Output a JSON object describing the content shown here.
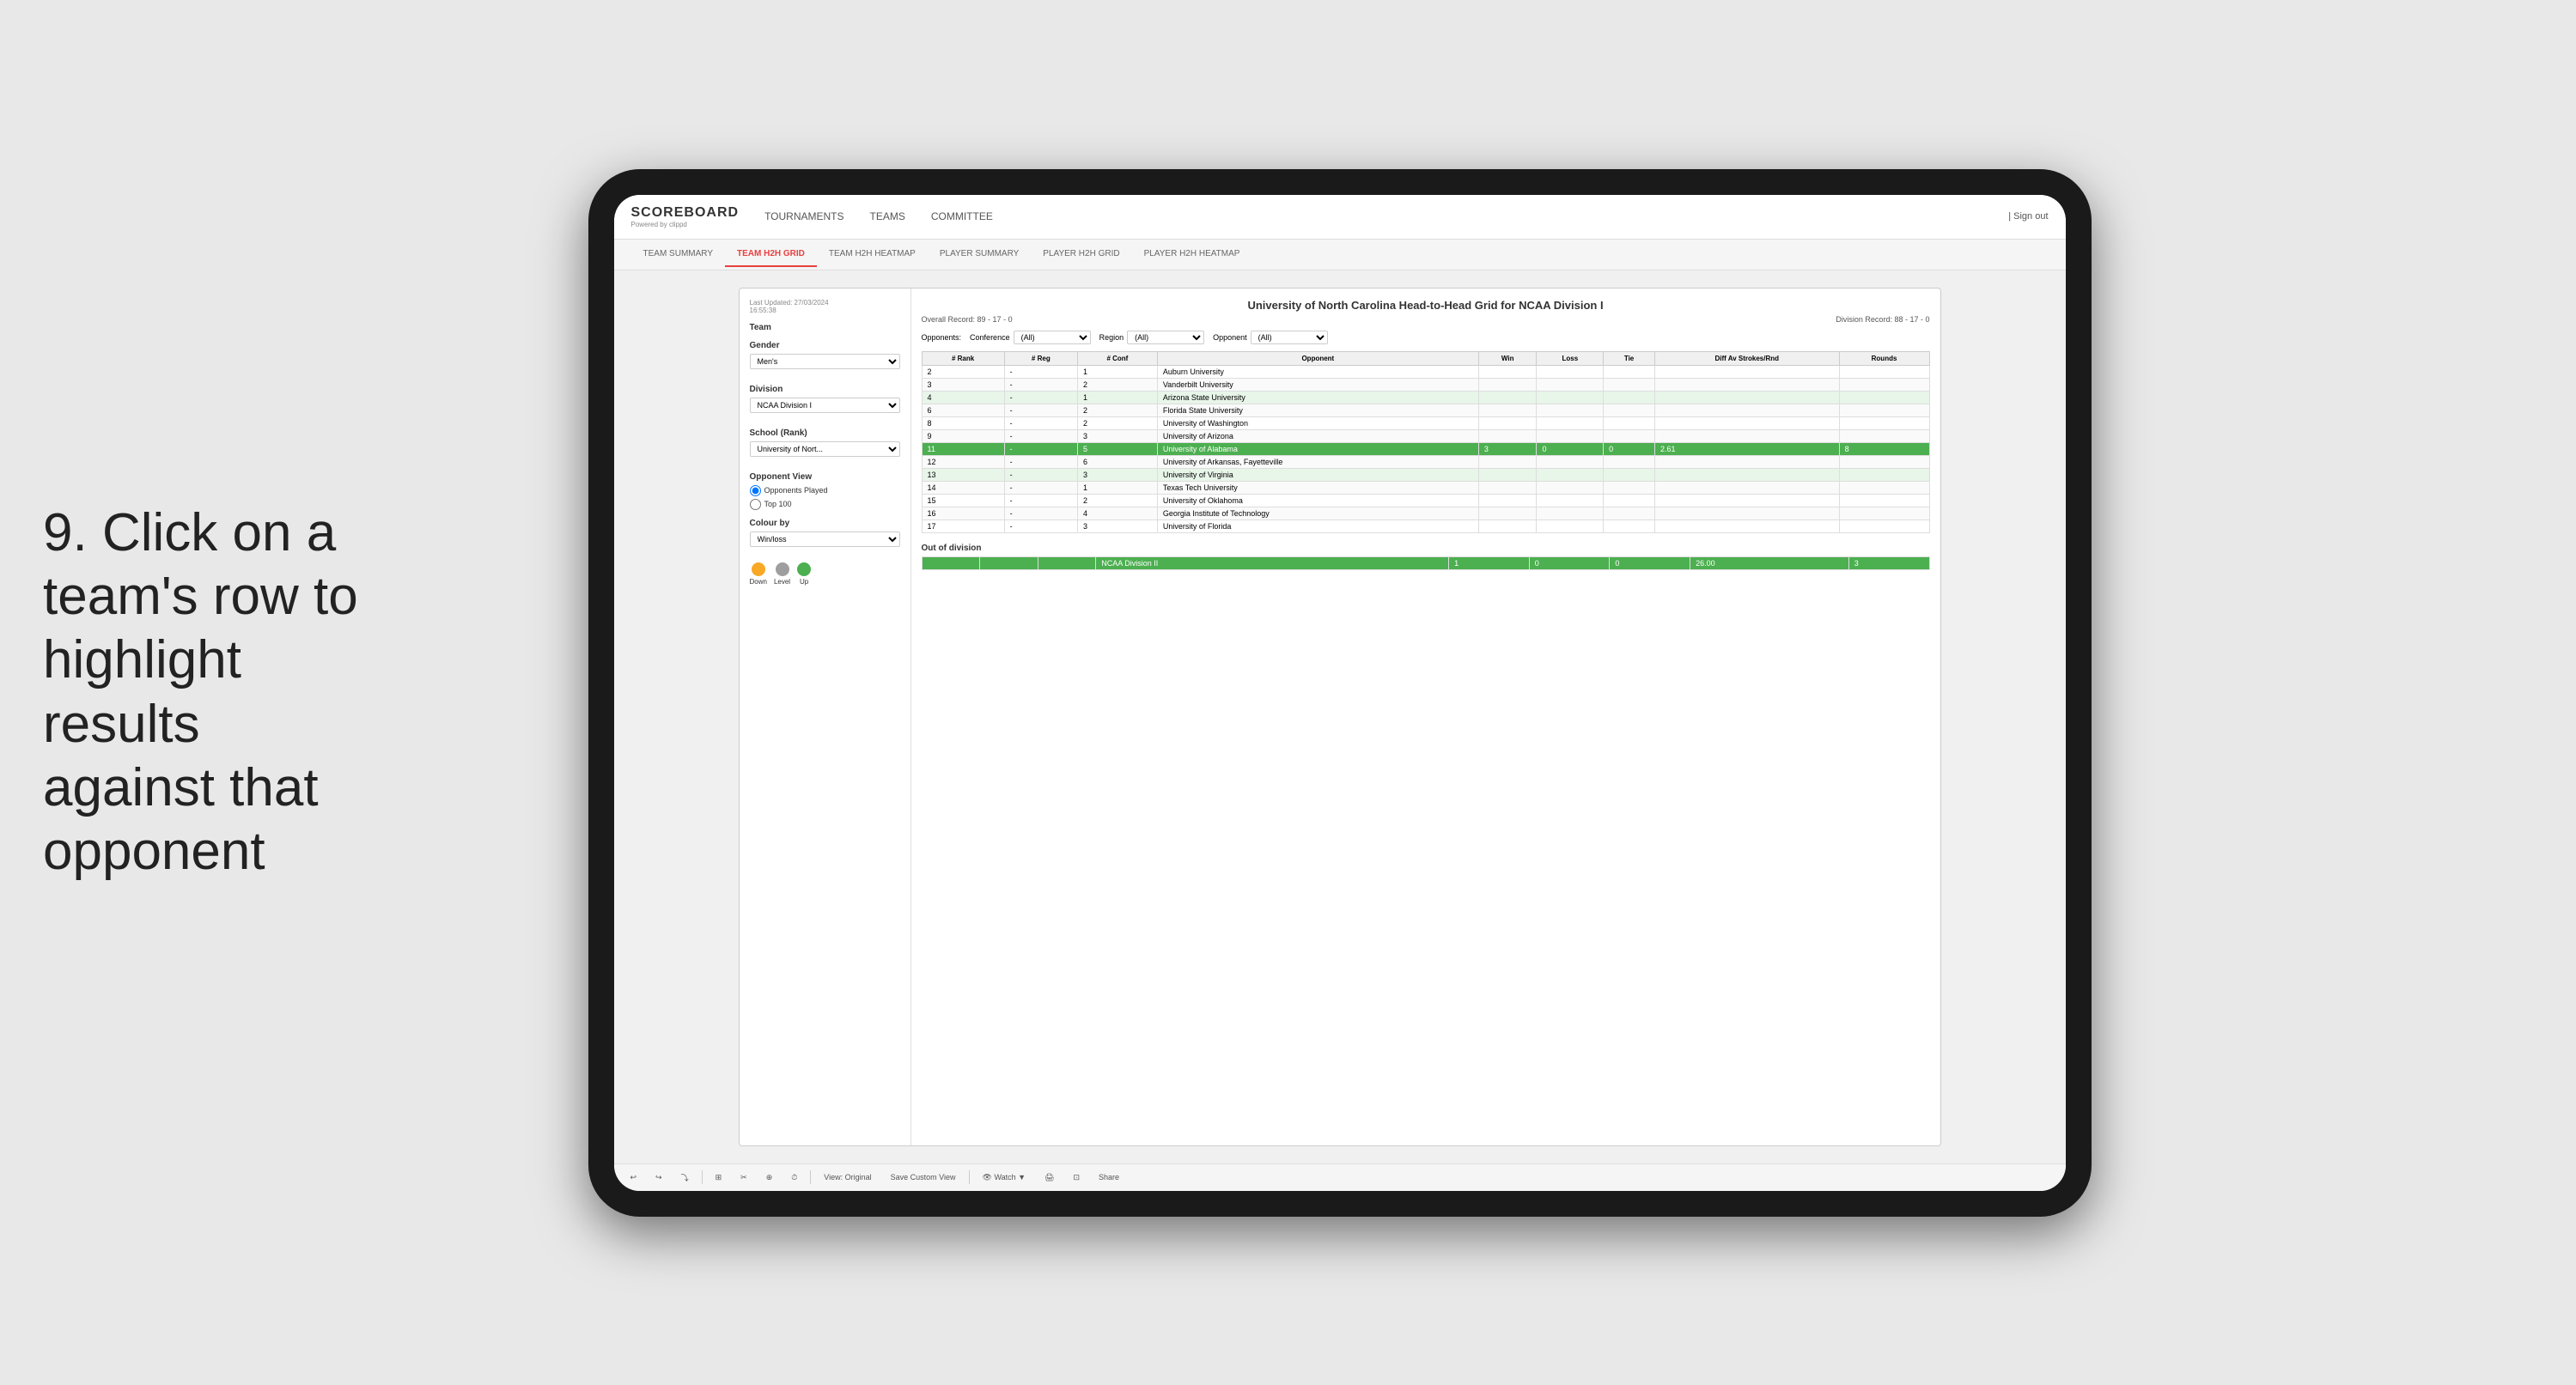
{
  "instruction": {
    "step": "9.",
    "text": "Click on a team's row to highlight results against that opponent"
  },
  "nav": {
    "logo": "SCOREBOARD",
    "logo_sub": "Powered by clippd",
    "links": [
      "TOURNAMENTS",
      "TEAMS",
      "COMMITTEE"
    ],
    "sign_out": "| Sign out"
  },
  "sub_tabs": [
    {
      "label": "TEAM SUMMARY",
      "active": false
    },
    {
      "label": "TEAM H2H GRID",
      "active": true
    },
    {
      "label": "TEAM H2H HEATMAP",
      "active": false
    },
    {
      "label": "PLAYER SUMMARY",
      "active": false
    },
    {
      "label": "PLAYER H2H GRID",
      "active": false
    },
    {
      "label": "PLAYER H2H HEATMAP",
      "active": false
    }
  ],
  "left_panel": {
    "last_updated_label": "Last Updated: 27/03/2024",
    "last_updated_time": "16:55:38",
    "team_label": "Team",
    "gender_label": "Gender",
    "gender_value": "Men's",
    "division_label": "Division",
    "division_value": "NCAA Division I",
    "school_label": "School (Rank)",
    "school_value": "University of Nort...",
    "opponent_view_label": "Opponent View",
    "radio_options": [
      "Opponents Played",
      "Top 100"
    ],
    "colour_by_label": "Colour by",
    "colour_value": "Win/loss",
    "legend": [
      {
        "label": "Down",
        "color": "#f9a825"
      },
      {
        "label": "Level",
        "color": "#9e9e9e"
      },
      {
        "label": "Up",
        "color": "#4caf50"
      }
    ]
  },
  "main_grid": {
    "title": "University of North Carolina Head-to-Head Grid for NCAA Division I",
    "overall_record_label": "Overall Record:",
    "overall_record": "89 - 17 - 0",
    "division_record_label": "Division Record:",
    "division_record": "88 - 17 - 0",
    "filters": {
      "opponents_label": "Opponents:",
      "conference_label": "Conference",
      "conference_value": "(All)",
      "region_label": "Region",
      "region_value": "(All)",
      "opponent_label": "Opponent",
      "opponent_value": "(All)"
    },
    "columns": [
      "# Rank",
      "# Reg",
      "# Conf",
      "Opponent",
      "Win",
      "Loss",
      "Tie",
      "Diff Av Strokes/Rnd",
      "Rounds"
    ],
    "rows": [
      {
        "rank": "2",
        "reg": "-",
        "conf": "1",
        "opponent": "Auburn University",
        "win": "",
        "loss": "",
        "tie": "",
        "diff": "",
        "rounds": "",
        "style": "normal"
      },
      {
        "rank": "3",
        "reg": "-",
        "conf": "2",
        "opponent": "Vanderbilt University",
        "win": "",
        "loss": "",
        "tie": "",
        "diff": "",
        "rounds": "",
        "style": "light-green"
      },
      {
        "rank": "4",
        "reg": "-",
        "conf": "1",
        "opponent": "Arizona State University",
        "win": "",
        "loss": "",
        "tie": "",
        "diff": "",
        "rounds": "",
        "style": "light-green"
      },
      {
        "rank": "6",
        "reg": "-",
        "conf": "2",
        "opponent": "Florida State University",
        "win": "",
        "loss": "",
        "tie": "",
        "diff": "",
        "rounds": "",
        "style": "light-yellow"
      },
      {
        "rank": "8",
        "reg": "-",
        "conf": "2",
        "opponent": "University of Washington",
        "win": "",
        "loss": "",
        "tie": "",
        "diff": "",
        "rounds": "",
        "style": "normal"
      },
      {
        "rank": "9",
        "reg": "-",
        "conf": "3",
        "opponent": "University of Arizona",
        "win": "",
        "loss": "",
        "tie": "",
        "diff": "",
        "rounds": "",
        "style": "normal"
      },
      {
        "rank": "11",
        "reg": "-",
        "conf": "5",
        "opponent": "University of Alabama",
        "win": "3",
        "loss": "0",
        "tie": "0",
        "diff": "2.61",
        "rounds": "8",
        "style": "highlighted"
      },
      {
        "rank": "12",
        "reg": "-",
        "conf": "6",
        "opponent": "University of Arkansas, Fayetteville",
        "win": "",
        "loss": "",
        "tie": "",
        "diff": "",
        "rounds": "",
        "style": "normal"
      },
      {
        "rank": "13",
        "reg": "-",
        "conf": "3",
        "opponent": "University of Virginia",
        "win": "",
        "loss": "",
        "tie": "",
        "diff": "",
        "rounds": "",
        "style": "light-green"
      },
      {
        "rank": "14",
        "reg": "-",
        "conf": "1",
        "opponent": "Texas Tech University",
        "win": "",
        "loss": "",
        "tie": "",
        "diff": "",
        "rounds": "",
        "style": "light-green"
      },
      {
        "rank": "15",
        "reg": "-",
        "conf": "2",
        "opponent": "University of Oklahoma",
        "win": "",
        "loss": "",
        "tie": "",
        "diff": "",
        "rounds": "",
        "style": "normal"
      },
      {
        "rank": "16",
        "reg": "-",
        "conf": "4",
        "opponent": "Georgia Institute of Technology",
        "win": "",
        "loss": "",
        "tie": "",
        "diff": "",
        "rounds": "",
        "style": "light-green"
      },
      {
        "rank": "17",
        "reg": "-",
        "conf": "3",
        "opponent": "University of Florida",
        "win": "",
        "loss": "",
        "tie": "",
        "diff": "",
        "rounds": "",
        "style": "normal"
      }
    ],
    "out_of_division_title": "Out of division",
    "out_of_division_rows": [
      {
        "opponent": "NCAA Division II",
        "win": "1",
        "loss": "0",
        "tie": "0",
        "diff": "26.00",
        "rounds": "3",
        "style": "highlighted"
      }
    ]
  },
  "toolbar": {
    "buttons": [
      "↩",
      "↪",
      "⤵",
      "⊞",
      "✂",
      "⊕",
      "⊘",
      "⏱",
      "View: Original",
      "Save Custom View",
      "👁 Watch ▼",
      "🖨",
      "⊡",
      "Share"
    ]
  }
}
